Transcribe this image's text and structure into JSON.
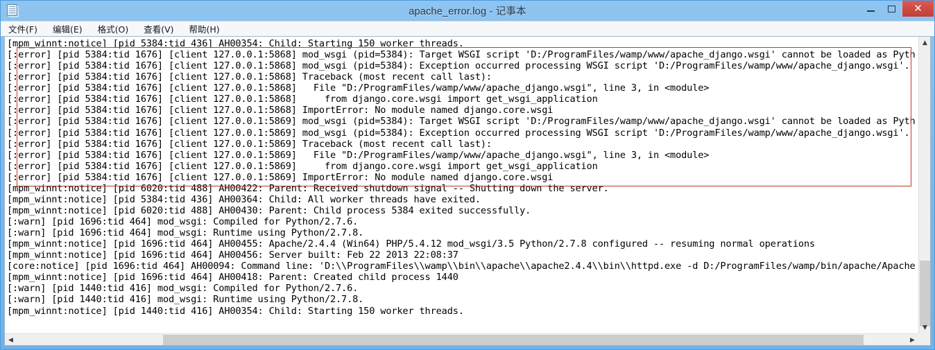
{
  "window": {
    "title": "apache_error.log - 记事本",
    "app_icon": "notepad-document-icon",
    "controls": {
      "minimize": "—",
      "maximize": "❐",
      "close": "✕"
    },
    "accent_title_bar": "#7ab8ec",
    "close_button_color": "#cf4b42"
  },
  "menu": {
    "items": [
      {
        "label": "文件(F)"
      },
      {
        "label": "编辑(E)"
      },
      {
        "label": "格式(O)"
      },
      {
        "label": "查看(V)"
      },
      {
        "label": "帮助(H)"
      }
    ]
  },
  "annotation": {
    "shape": "rectangle",
    "color": "#c0392b",
    "covers_lines": "2-13"
  },
  "editor": {
    "font": "monospace",
    "lines": [
      "[mpm_winnt:notice] [pid 5384:tid 436] AH00354: Child: Starting 150 worker threads.",
      "[:error] [pid 5384:tid 1676] [client 127.0.0.1:5868] mod_wsgi (pid=5384): Target WSGI script 'D:/ProgramFiles/wamp/www/apache_django.wsgi' cannot be loaded as Pyth",
      "[:error] [pid 5384:tid 1676] [client 127.0.0.1:5868] mod_wsgi (pid=5384): Exception occurred processing WSGI script 'D:/ProgramFiles/wamp/www/apache_django.wsgi'.",
      "[:error] [pid 5384:tid 1676] [client 127.0.0.1:5868] Traceback (most recent call last):",
      "[:error] [pid 5384:tid 1676] [client 127.0.0.1:5868]   File \"D:/ProgramFiles/wamp/www/apache_django.wsgi\", line 3, in <module>",
      "[:error] [pid 5384:tid 1676] [client 127.0.0.1:5868]     from django.core.wsgi import get_wsgi_application",
      "[:error] [pid 5384:tid 1676] [client 127.0.0.1:5868] ImportError: No module named django.core.wsgi",
      "[:error] [pid 5384:tid 1676] [client 127.0.0.1:5869] mod_wsgi (pid=5384): Target WSGI script 'D:/ProgramFiles/wamp/www/apache_django.wsgi' cannot be loaded as Pyth",
      "[:error] [pid 5384:tid 1676] [client 127.0.0.1:5869] mod_wsgi (pid=5384): Exception occurred processing WSGI script 'D:/ProgramFiles/wamp/www/apache_django.wsgi'.",
      "[:error] [pid 5384:tid 1676] [client 127.0.0.1:5869] Traceback (most recent call last):",
      "[:error] [pid 5384:tid 1676] [client 127.0.0.1:5869]   File \"D:/ProgramFiles/wamp/www/apache_django.wsgi\", line 3, in <module>",
      "[:error] [pid 5384:tid 1676] [client 127.0.0.1:5869]     from django.core.wsgi import get_wsgi_application",
      "[:error] [pid 5384:tid 1676] [client 127.0.0.1:5869] ImportError: No module named django.core.wsgi",
      "[mpm_winnt:notice] [pid 6020:tid 488] AH00422: Parent: Received shutdown signal -- Shutting down the server.",
      "[mpm_winnt:notice] [pid 5384:tid 436] AH00364: Child: All worker threads have exited.",
      "[mpm_winnt:notice] [pid 6020:tid 488] AH00430: Parent: Child process 5384 exited successfully.",
      "[:warn] [pid 1696:tid 464] mod_wsgi: Compiled for Python/2.7.6.",
      "[:warn] [pid 1696:tid 464] mod_wsgi: Runtime using Python/2.7.8.",
      "[mpm_winnt:notice] [pid 1696:tid 464] AH00455: Apache/2.4.4 (Win64) PHP/5.4.12 mod_wsgi/3.5 Python/2.7.8 configured -- resuming normal operations",
      "[mpm_winnt:notice] [pid 1696:tid 464] AH00456: Server built: Feb 22 2013 22:08:37",
      "[core:notice] [pid 1696:tid 464] AH00094: Command line: 'D:\\\\ProgramFiles\\\\wamp\\\\bin\\\\apache\\\\apache2.4.4\\\\bin\\\\httpd.exe -d D:/ProgramFiles/wamp/bin/apache/Apache",
      "[mpm_winnt:notice] [pid 1696:tid 464] AH00418: Parent: Created child process 1440",
      "[:warn] [pid 1440:tid 416] mod_wsgi: Compiled for Python/2.7.6.",
      "[:warn] [pid 1440:tid 416] mod_wsgi: Runtime using Python/2.7.8.",
      "[mpm_winnt:notice] [pid 1440:tid 416] AH00354: Child: Starting 150 worker threads."
    ]
  },
  "scrollbars": {
    "vertical": {
      "up_arrow": "▲",
      "down_arrow": "▼"
    },
    "horizontal": {
      "left_arrow": "◀",
      "right_arrow": "▶"
    }
  }
}
